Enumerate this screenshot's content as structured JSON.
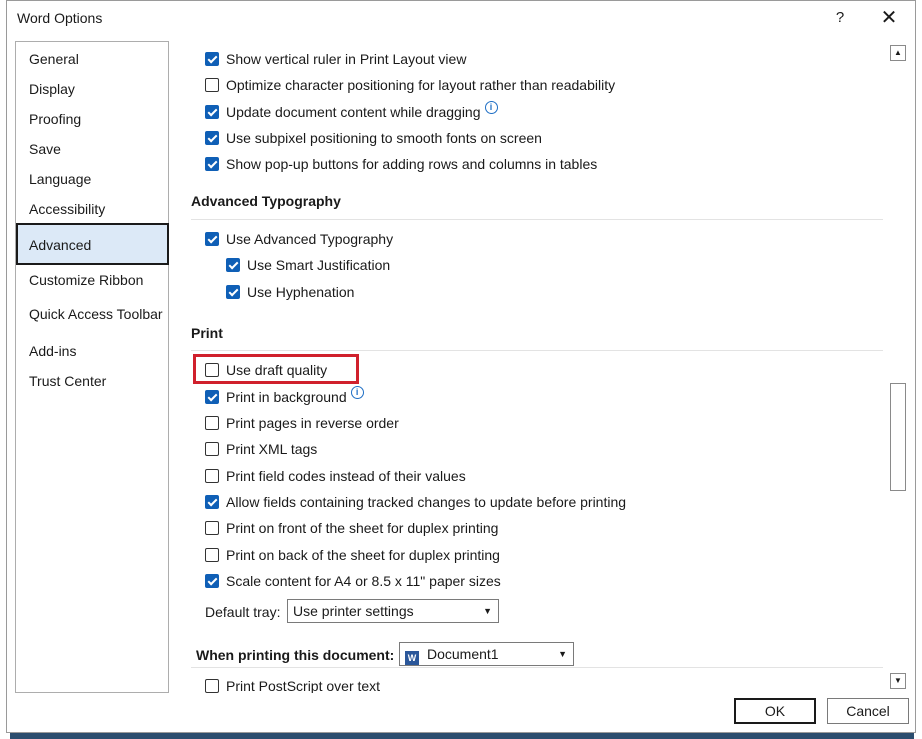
{
  "window": {
    "title": "Word Options",
    "help_label": "?",
    "close_label": "✕"
  },
  "nav": {
    "items": [
      {
        "label": "General"
      },
      {
        "label": "Display"
      },
      {
        "label": "Proofing"
      },
      {
        "label": "Save"
      },
      {
        "label": "Language"
      },
      {
        "label": "Accessibility"
      },
      {
        "label": "Advanced",
        "selected": true
      },
      {
        "label": "Customize Ribbon"
      },
      {
        "label": "Quick Access Toolbar"
      },
      {
        "label": "Add-ins"
      },
      {
        "label": "Trust Center"
      }
    ]
  },
  "display_options": [
    {
      "label": "Show vertical ruler in Print Layout view",
      "checked": true
    },
    {
      "label": "Optimize character positioning for layout rather than readability",
      "checked": false
    },
    {
      "label": "Update document content while dragging",
      "checked": true,
      "info": true
    },
    {
      "label": "Use subpixel positioning to smooth fonts on screen",
      "checked": true
    },
    {
      "label": "Show pop-up buttons for adding rows and columns in tables",
      "checked": true
    }
  ],
  "typography": {
    "heading": "Advanced Typography",
    "options": [
      {
        "label": "Use Advanced Typography",
        "checked": true
      },
      {
        "label": "Use Smart Justification",
        "checked": true
      },
      {
        "label": "Use Hyphenation",
        "checked": true
      }
    ]
  },
  "print": {
    "heading": "Print",
    "options": [
      {
        "label": "Use draft quality",
        "checked": false
      },
      {
        "label": "Print in background",
        "checked": true,
        "info": true
      },
      {
        "label": "Print pages in reverse order",
        "checked": false
      },
      {
        "label": "Print XML tags",
        "checked": false
      },
      {
        "label": "Print field codes instead of their values",
        "checked": false
      },
      {
        "label": "Allow fields containing tracked changes to update before printing",
        "checked": true
      },
      {
        "label": "Print on front of the sheet for duplex printing",
        "checked": false
      },
      {
        "label": "Print on back of the sheet for duplex printing",
        "checked": false
      },
      {
        "label": "Scale content for A4 or 8.5 x 11\" paper sizes",
        "checked": true
      }
    ],
    "default_tray_label": "Default tray:",
    "default_tray_value": "Use printer settings"
  },
  "when_printing": {
    "heading": "When printing this document:",
    "document": "Document1",
    "doc_icon": "W",
    "options": [
      {
        "label": "Print PostScript over text",
        "checked": false
      }
    ]
  },
  "buttons": {
    "ok": "OK",
    "cancel": "Cancel"
  },
  "icons": {
    "info": "i",
    "dropdown": "▼",
    "scroll_up": "▲",
    "scroll_down": "▼"
  },
  "colors": {
    "accent": "#0f5fb6",
    "highlight": "#d0202c",
    "selected_bg": "#dce9f7"
  }
}
